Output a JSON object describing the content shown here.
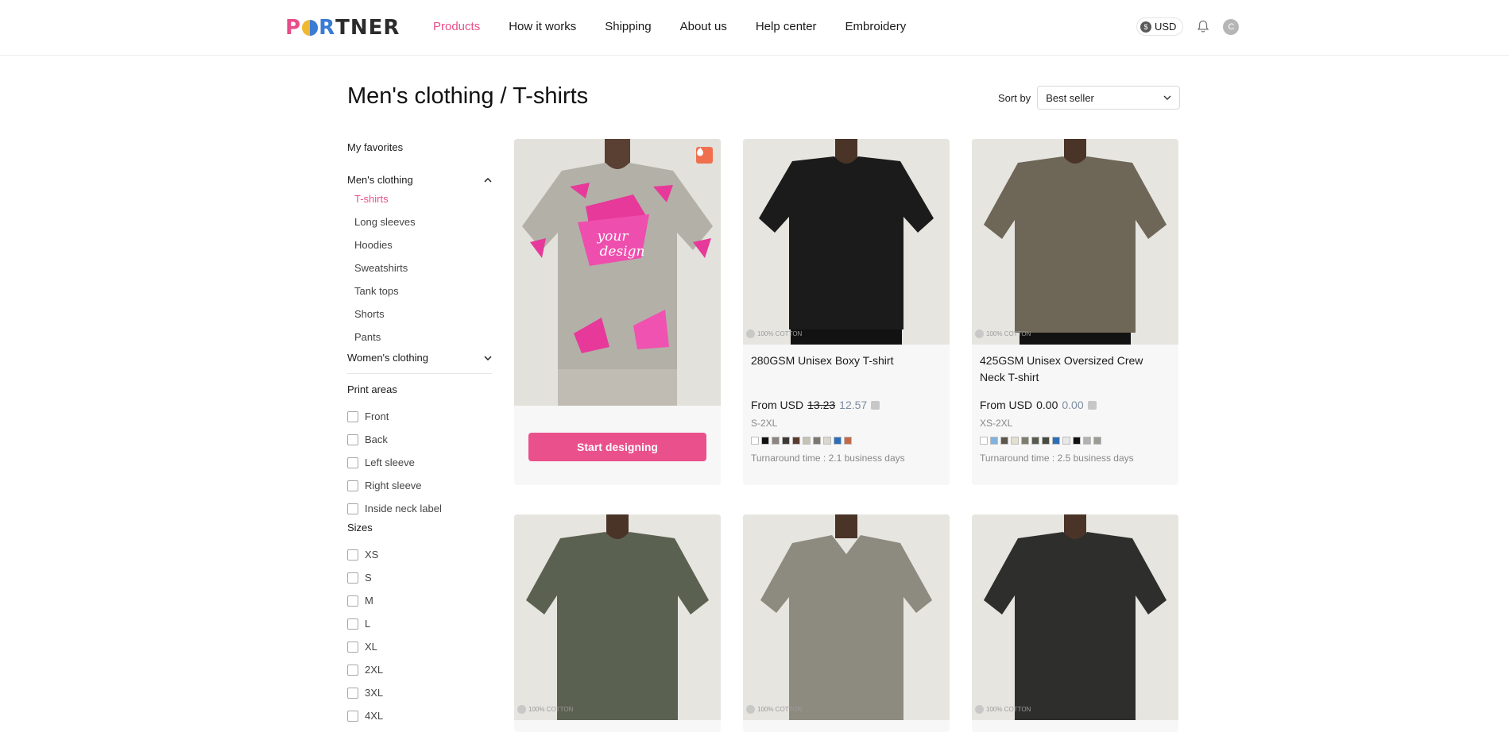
{
  "header": {
    "logo_text": "PORTNER",
    "nav": [
      "Products",
      "How it works",
      "Shipping",
      "About us",
      "Help center",
      "Embroidery"
    ],
    "active_nav": "Products",
    "currency": "USD",
    "avatar_initial": "C"
  },
  "page": {
    "title": "Men's clothing / T-shirts",
    "sort_label": "Sort by",
    "sort_value": "Best seller"
  },
  "sidebar": {
    "favorites": "My favorites",
    "mens": "Men's clothing",
    "mens_items": [
      "T-shirts",
      "Long sleeves",
      "Hoodies",
      "Sweatshirts",
      "Tank tops",
      "Shorts",
      "Pants"
    ],
    "active_item": "T-shirts",
    "womens": "Women's clothing",
    "print_areas_title": "Print areas",
    "print_areas": [
      "Front",
      "Back",
      "Left sleeve",
      "Right sleeve",
      "Inside neck label"
    ],
    "sizes_title": "Sizes",
    "sizes": [
      "XS",
      "S",
      "M",
      "L",
      "XL",
      "2XL",
      "3XL",
      "4XL"
    ]
  },
  "promo": {
    "design_text_1": "your",
    "design_text_2": "design",
    "button": "Start designing"
  },
  "cotton_badge": "100% COTTON",
  "products": [
    {
      "title": "280GSM Unisex Boxy T-shirt",
      "price_prefix": "From USD",
      "old_price": "13.23",
      "new_price": "12.57",
      "sizes": "S-2XL",
      "swatches": [
        "#ffffff",
        "#111111",
        "#8a8580",
        "#3b3836",
        "#5a3a2e",
        "#c6c3b4",
        "#7a7770",
        "#ddd6cc",
        "#2d6db5",
        "#c46a48"
      ],
      "turnaround": "Turnaround time : 2.1 business days",
      "shirt_color": "#1b1b1b"
    },
    {
      "title": "425GSM Unisex Oversized Crew Neck T-shirt",
      "price_prefix": "From USD",
      "old_price": "0.00",
      "new_price": "0.00",
      "sizes": "XS-2XL",
      "swatches": [
        "#ffffff",
        "#7fb3e0",
        "#5d564f",
        "#e5dfd2",
        "#817d6c",
        "#595b4f",
        "#474a3f",
        "#2d6db5",
        "#e8e8e8",
        "#111111",
        "#b1b1b1",
        "#9d9a94"
      ],
      "turnaround": "Turnaround time : 2.5 business days",
      "shirt_color": "#6e6657"
    },
    {
      "shirt_color": "#5b6150"
    },
    {
      "shirt_color": "#8d8b7f"
    },
    {
      "shirt_color": "#2e2e2c"
    }
  ]
}
